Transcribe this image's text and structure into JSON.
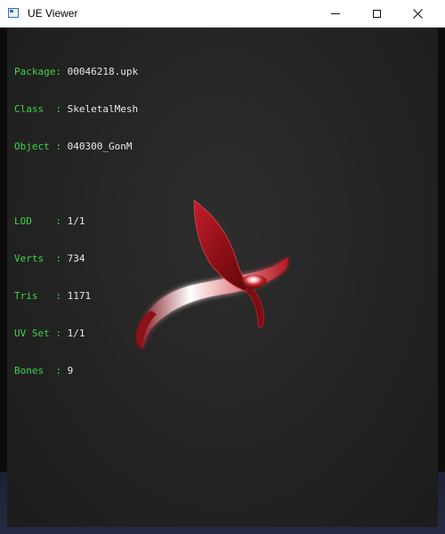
{
  "window": {
    "title": "UE Viewer"
  },
  "info": {
    "package_label": "Package:",
    "package_value": "00046218.upk",
    "class_label": "Class  :",
    "class_value": "SkeletalMesh",
    "object_label": "Object :",
    "object_value": "040300_GonM",
    "lod_label": "LOD    :",
    "lod_value": "1/1",
    "verts_label": "Verts  :",
    "verts_value": "734",
    "tris_label": "Tris   :",
    "tris_value": "1171",
    "uvset_label": "UV Set :",
    "uvset_value": "1/1",
    "bones_label": "Bones  :",
    "bones_value": "9"
  },
  "colors": {
    "label_green": "#3fd24a",
    "value_white": "#e8e8e8",
    "mesh_red": "#a0121a"
  },
  "icons": {
    "app": "window-app-icon",
    "minimize": "minimize-icon",
    "maximize": "maximize-icon",
    "close": "close-icon"
  }
}
